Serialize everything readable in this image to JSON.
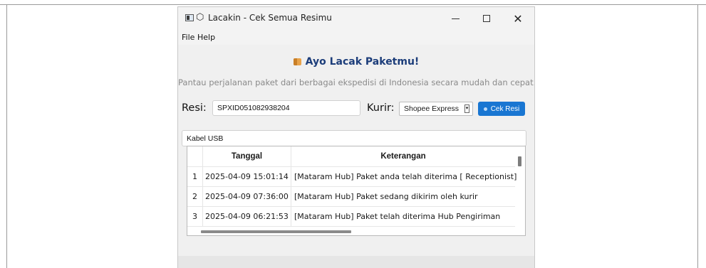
{
  "window": {
    "title": "Lacakin - Cek Semua Resimu",
    "min_icon": "minimize-icon",
    "max_icon": "maximize-icon",
    "close_label": "✕"
  },
  "menu": {
    "file": "File",
    "help": "Help"
  },
  "main": {
    "heading": "Ayo Lacak Paketmu!",
    "subtitle": "Pantau perjalanan paket dari berbagai ekspedisi di Indonesia secara mudah dan cepat.",
    "resi_label": "Resi:",
    "resi_value": "SPXID051082938204",
    "kurir_label": "Kurir:",
    "kurir_value": "Shopee Express",
    "check_button": "Cek Resi",
    "note_value": "Kabel USB"
  },
  "table": {
    "headers": [
      "Tanggal",
      "Keterangan"
    ],
    "rows": [
      {
        "index": "1",
        "date": "2025-04-09 15:01:14",
        "desc": "[Mataram Hub] Paket anda telah diterima  [ Receptionist]"
      },
      {
        "index": "2",
        "date": "2025-04-09 07:36:00",
        "desc": "[Mataram Hub] Paket sedang dikirim oleh kurir"
      },
      {
        "index": "3",
        "date": "2025-04-09 06:21:53",
        "desc": "[Mataram Hub] Paket telah diterima Hub Pengiriman"
      }
    ]
  },
  "colors": {
    "accent": "#1976d2",
    "heading": "#1c3d7a"
  }
}
